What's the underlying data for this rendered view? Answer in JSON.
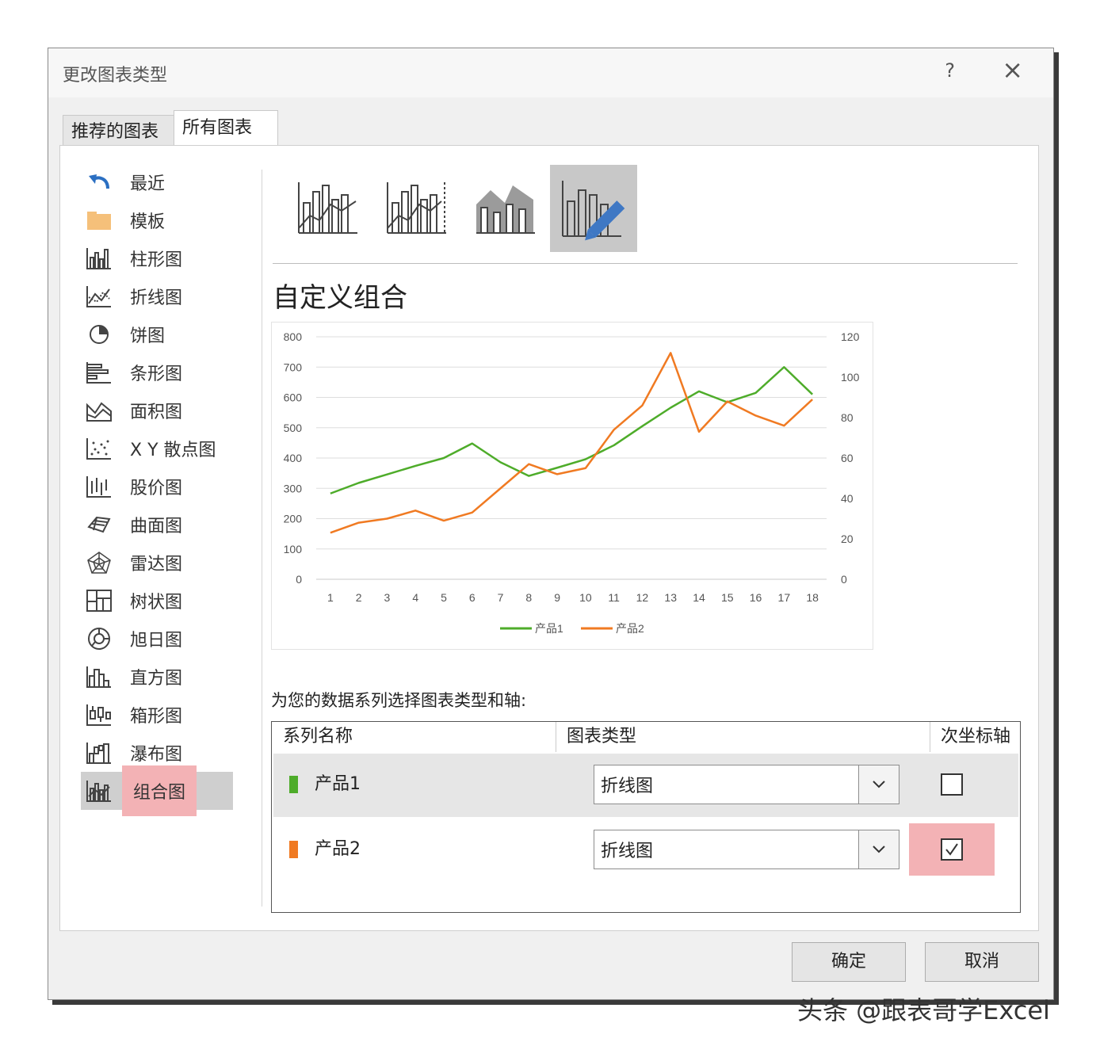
{
  "dialog": {
    "title": "更改图表类型",
    "help": "?",
    "close": "×",
    "tabs": [
      "推荐的图表",
      "所有图表"
    ]
  },
  "sidebar": {
    "items": [
      {
        "label": "最近",
        "icon": "undo-arrow-icon"
      },
      {
        "label": "模板",
        "icon": "folder-icon"
      },
      {
        "label": "柱形图",
        "icon": "column-chart-icon"
      },
      {
        "label": "折线图",
        "icon": "line-chart-icon"
      },
      {
        "label": "饼图",
        "icon": "pie-chart-icon"
      },
      {
        "label": "条形图",
        "icon": "bar-chart-icon"
      },
      {
        "label": "面积图",
        "icon": "area-chart-icon"
      },
      {
        "label": "X Y 散点图",
        "icon": "scatter-chart-icon"
      },
      {
        "label": "股价图",
        "icon": "stock-chart-icon"
      },
      {
        "label": "曲面图",
        "icon": "surface-chart-icon"
      },
      {
        "label": "雷达图",
        "icon": "radar-chart-icon"
      },
      {
        "label": "树状图",
        "icon": "treemap-chart-icon"
      },
      {
        "label": "旭日图",
        "icon": "sunburst-chart-icon"
      },
      {
        "label": "直方图",
        "icon": "histogram-chart-icon"
      },
      {
        "label": "箱形图",
        "icon": "box-whisker-chart-icon"
      },
      {
        "label": "瀑布图",
        "icon": "waterfall-chart-icon"
      },
      {
        "label": "组合图",
        "icon": "combo-chart-icon",
        "selected": true
      }
    ]
  },
  "main": {
    "combo_title": "自定义组合",
    "prompt": "为您的数据系列选择图表类型和轴:",
    "table": {
      "headers": [
        "系列名称",
        "图表类型",
        "次坐标轴"
      ],
      "rows": [
        {
          "name": "产品1",
          "color": "#4eac2a",
          "type": "折线图",
          "secondary": false
        },
        {
          "name": "产品2",
          "color": "#f07a22",
          "type": "折线图",
          "secondary": true
        }
      ]
    }
  },
  "buttons": {
    "ok": "确定",
    "cancel": "取消"
  },
  "watermark": "头条 @跟表哥学Excel",
  "chart_data": {
    "type": "line",
    "x": [
      1,
      2,
      3,
      4,
      5,
      6,
      7,
      8,
      9,
      10,
      11,
      12,
      13,
      14,
      15,
      16,
      17,
      18
    ],
    "series": [
      {
        "name": "产品1",
        "color": "#4eac2a",
        "axis": "primary",
        "values": [
          283,
          318,
          346,
          374,
          400,
          448,
          386,
          341,
          368,
          396,
          442,
          505,
          566,
          620,
          584,
          615,
          700,
          610
        ]
      },
      {
        "name": "产品2",
        "color": "#f07a22",
        "axis": "secondary",
        "values": [
          23,
          28,
          30,
          34,
          29,
          33,
          45,
          57,
          52,
          55,
          74,
          86,
          112,
          73,
          88,
          81,
          76,
          89
        ]
      }
    ],
    "y_ticks": [
      0,
      100,
      200,
      300,
      400,
      500,
      600,
      700,
      800
    ],
    "y2_ticks": [
      0,
      20,
      40,
      60,
      80,
      100,
      120
    ],
    "ylim": [
      0,
      800
    ],
    "y2lim": [
      0,
      120
    ],
    "grid": true,
    "legend": "bottom"
  }
}
